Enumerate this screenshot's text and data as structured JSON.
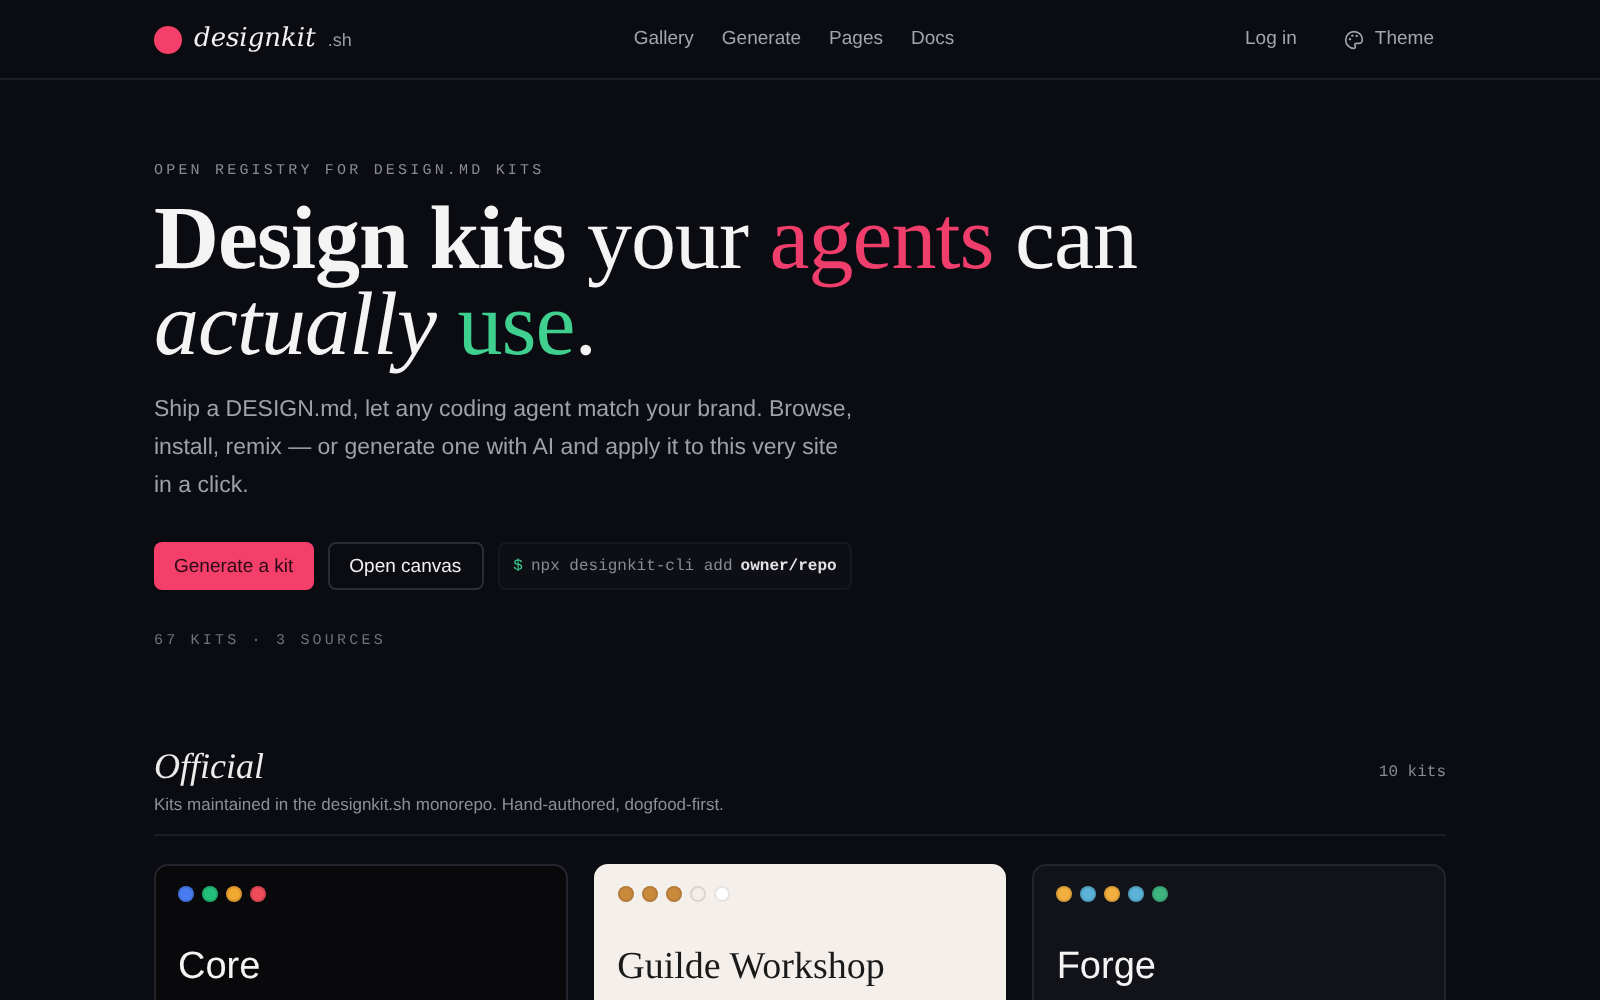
{
  "nav": {
    "logo": "designkit",
    "logo_suffix": ".sh",
    "links": [
      "Gallery",
      "Generate",
      "Pages",
      "Docs"
    ],
    "login": "Log in",
    "theme": "Theme"
  },
  "hero": {
    "eyebrow": "OPEN REGISTRY FOR DESIGN.MD KITS",
    "headline": {
      "bold_part": "Design kits",
      "middle": "your",
      "accent_word": "agents",
      "line_end": "can",
      "italic_word": "actually",
      "green_word": "use",
      "final": "."
    },
    "description": "Ship a DESIGN.md, let any coding agent match your brand. Browse, install, remix — or generate one with AI and apply it to this very site in a click.",
    "buttons": [
      {
        "label": "Generate a kit",
        "kind": "primary"
      },
      {
        "label": "Open canvas",
        "kind": "secondary"
      }
    ],
    "command": {
      "prompt": "$",
      "text": "npx designkit-cli add",
      "arg": "owner/repo"
    },
    "stats": "67 KITS · 3 SOURCES"
  },
  "section": {
    "title": "Official",
    "subtitle": "Kits maintained in the designkit.sh monorepo. Hand-authored, dogfood-first.",
    "count": "10 kits",
    "cards": [
      {
        "name": "Core",
        "kind": "dark",
        "swatches": [
          {
            "color": "#4a7cf0"
          },
          {
            "color": "#22c07a"
          },
          {
            "color": "#f0a830"
          },
          {
            "color": "#ef4b5a"
          }
        ]
      },
      {
        "name": "Guilde Workshop",
        "kind": "light",
        "swatches": [
          {
            "color": "#c98a3e"
          },
          {
            "color": "#c98a3e"
          },
          {
            "color": "#c98a3e"
          },
          {
            "color": "#f3eee8"
          },
          {
            "color": "#ffffff"
          }
        ]
      },
      {
        "name": "Forge",
        "kind": "slate",
        "swatches": [
          {
            "color": "#f2b040"
          },
          {
            "color": "#5ab3d6"
          },
          {
            "color": "#f2b040"
          },
          {
            "color": "#5ab3d6"
          },
          {
            "color": "#3fb37f"
          }
        ]
      }
    ]
  }
}
